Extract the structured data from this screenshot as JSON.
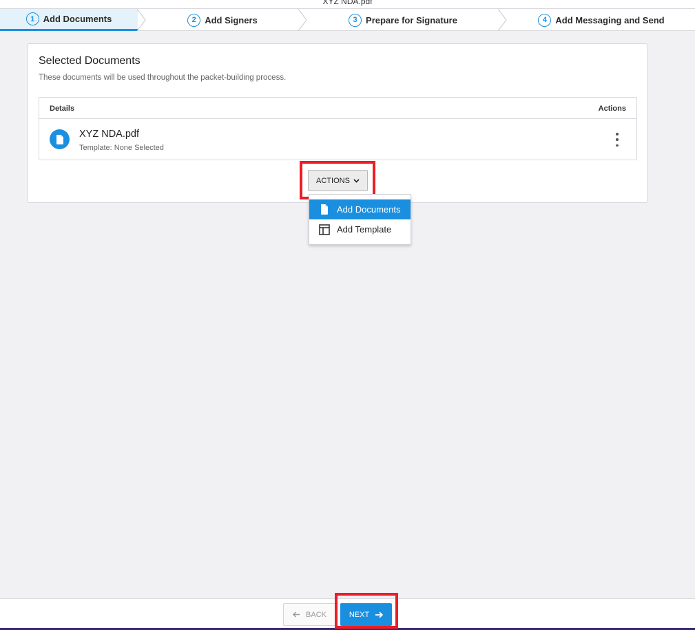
{
  "window": {
    "title": "XYZ NDA.pdf"
  },
  "stepper": {
    "steps": [
      {
        "number": "1",
        "label": "Add Documents"
      },
      {
        "number": "2",
        "label": "Add Signers"
      },
      {
        "number": "3",
        "label": "Prepare for Signature"
      },
      {
        "number": "4",
        "label": "Add Messaging and Send"
      }
    ]
  },
  "card": {
    "title": "Selected Documents",
    "subtitle": "These documents will be used throughout the packet-building process.",
    "table": {
      "headers": {
        "details": "Details",
        "actions": "Actions"
      },
      "rows": [
        {
          "name": "XYZ NDA.pdf",
          "template": "Template: None Selected",
          "icon": "document-icon"
        }
      ]
    }
  },
  "actions_button": {
    "label": "ACTIONS",
    "icon": "chevron-down-icon"
  },
  "actions_menu": {
    "items": [
      {
        "label": "Add Documents",
        "icon": "document-icon"
      },
      {
        "label": "Add Template",
        "icon": "template-icon"
      }
    ]
  },
  "footer": {
    "back_label": "BACK",
    "next_label": "NEXT"
  },
  "colors": {
    "accent": "#1a8fe0",
    "highlight": "#ee1c24",
    "active_step_bg": "#e4f2fb"
  }
}
